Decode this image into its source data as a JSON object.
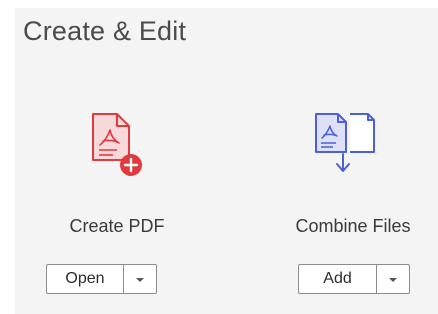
{
  "section": {
    "title": "Create & Edit"
  },
  "tools": [
    {
      "label": "Create PDF",
      "button_label": "Open",
      "icon": "create-pdf-icon",
      "accent_color": "#e03a3e",
      "tint_color": "#f7d9d9"
    },
    {
      "label": "Combine Files",
      "button_label": "Add",
      "icon": "combine-files-icon",
      "accent_color": "#4b5fd6",
      "tint_color": "#dde0f7"
    }
  ]
}
